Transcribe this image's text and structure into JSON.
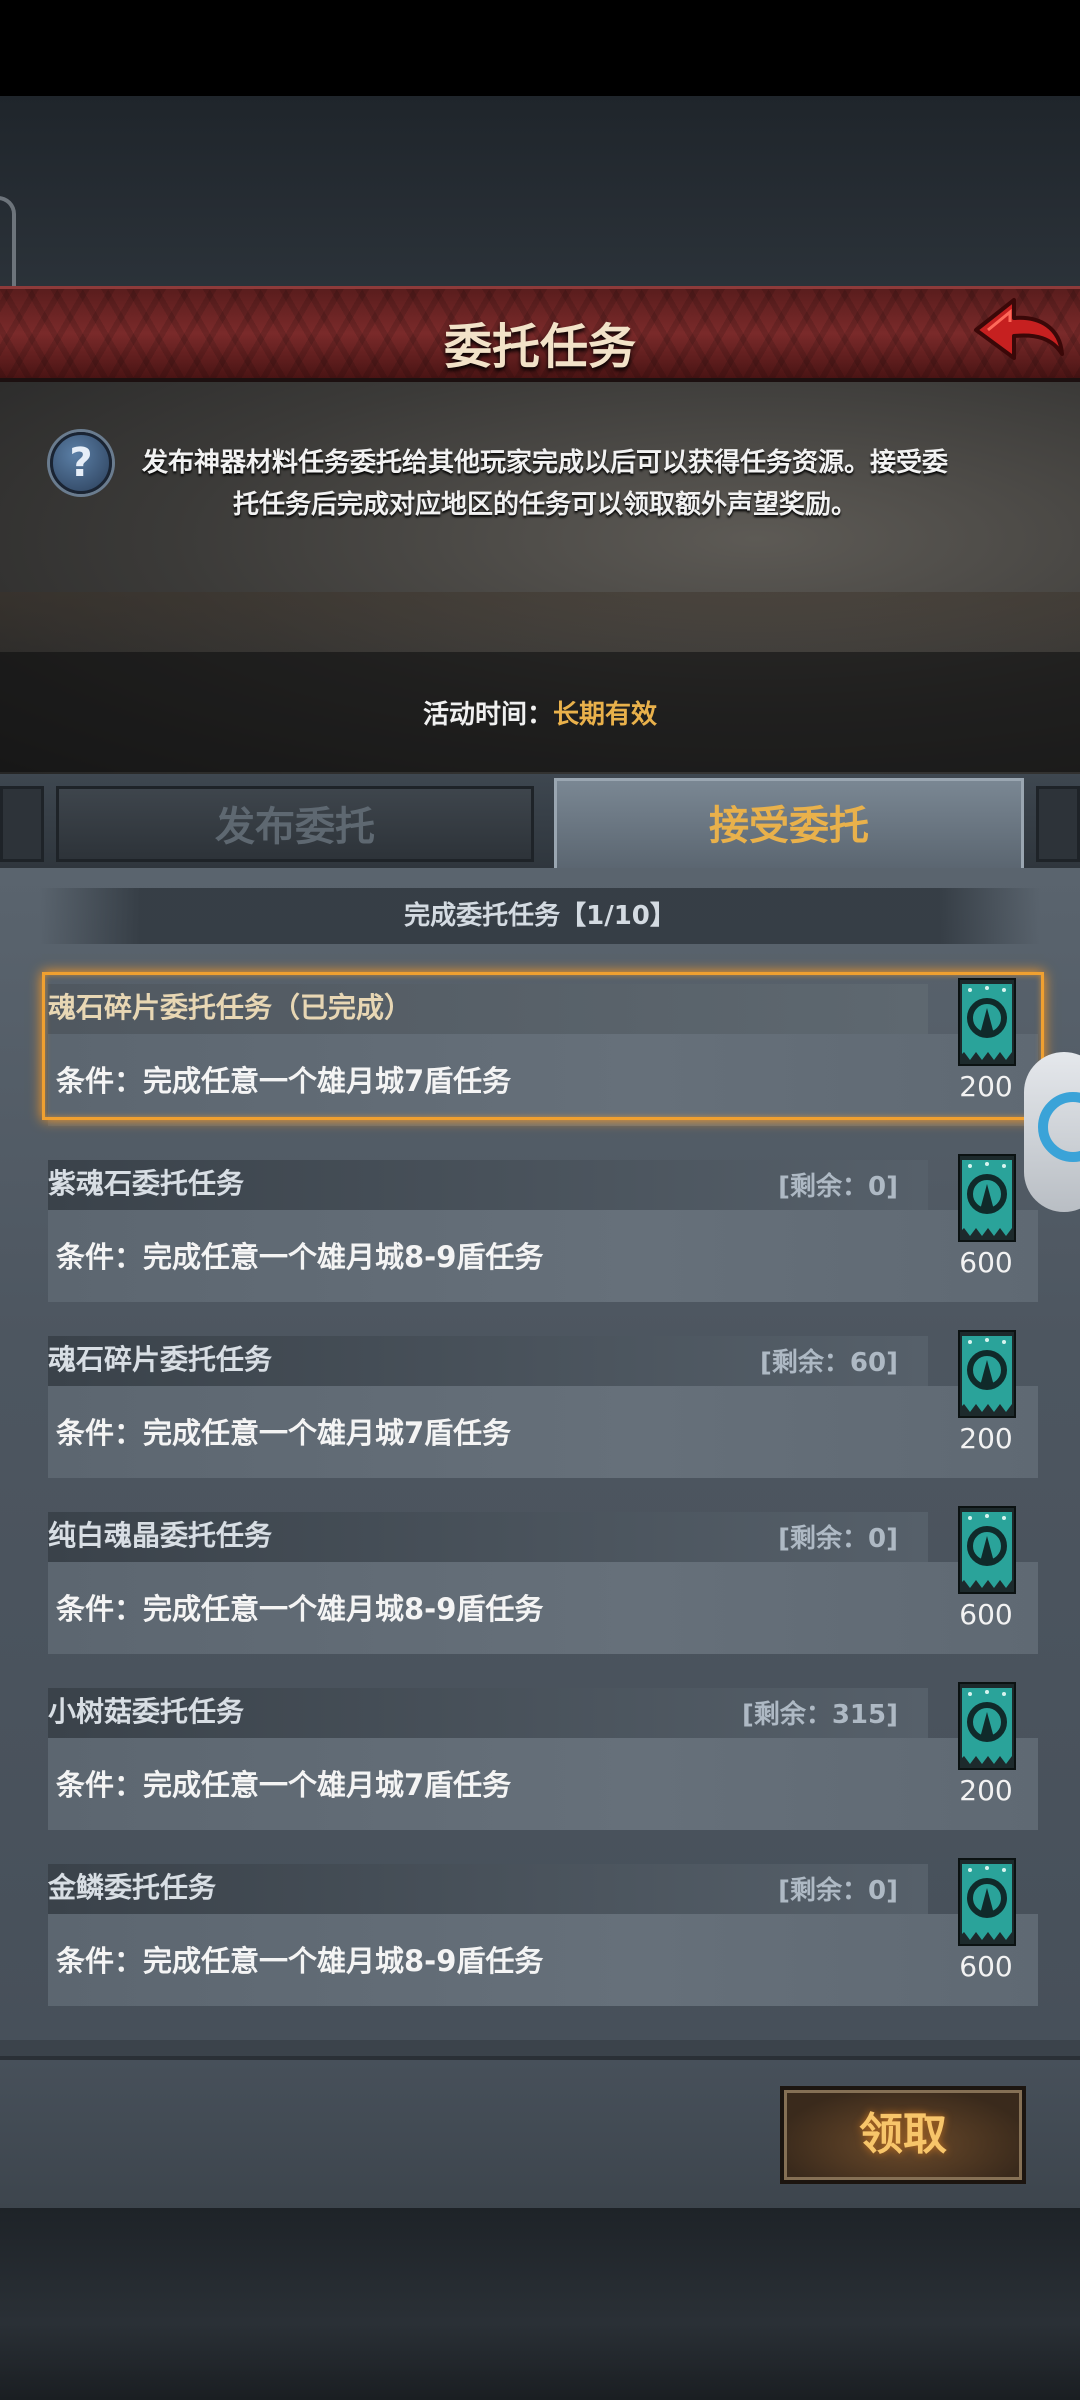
{
  "header": {
    "title": "委托任务",
    "back_icon": "back-arrow-icon"
  },
  "banner": {
    "help_symbol": "?",
    "description": "发布神器材料任务委托给其他玩家完成以后可以获得任务资源。接受委托任务后完成对应地区的任务可以领取额外声望奖励。",
    "time_label": "活动时间：",
    "time_value": "长期有效"
  },
  "tabs": [
    {
      "label": "发布委托",
      "active": false
    },
    {
      "label": "接受委托",
      "active": true
    }
  ],
  "progress": "完成委托任务【1/10】",
  "tasks": [
    {
      "name": "魂石碎片委托任务（已完成）",
      "remaining": "",
      "condition": "条件：完成任意一个雄月城7盾任务",
      "reward": "200",
      "selected": true
    },
    {
      "name": "紫魂石委托任务",
      "remaining": "[剩余：0]",
      "condition": "条件：完成任意一个雄月城8-9盾任务",
      "reward": "600",
      "selected": false
    },
    {
      "name": "魂石碎片委托任务",
      "remaining": "[剩余：60]",
      "condition": "条件：完成任意一个雄月城7盾任务",
      "reward": "200",
      "selected": false
    },
    {
      "name": "纯白魂晶委托任务",
      "remaining": "[剩余：0]",
      "condition": "条件：完成任意一个雄月城8-9盾任务",
      "reward": "600",
      "selected": false
    },
    {
      "name": "小树菇委托任务",
      "remaining": "[剩余：315]",
      "condition": "条件：完成任意一个雄月城7盾任务",
      "reward": "200",
      "selected": false
    },
    {
      "name": "金鳞委托任务",
      "remaining": "[剩余：0]",
      "condition": "条件：完成任意一个雄月城8-9盾任务",
      "reward": "600",
      "selected": false
    }
  ],
  "reward_icon": "reputation-banner-icon",
  "claim_button": "领取",
  "colors": {
    "accent": "#e9b14b",
    "header_red": "#7a2a2a",
    "badge_teal": "#2aa39a",
    "selection": "#f0a030"
  }
}
